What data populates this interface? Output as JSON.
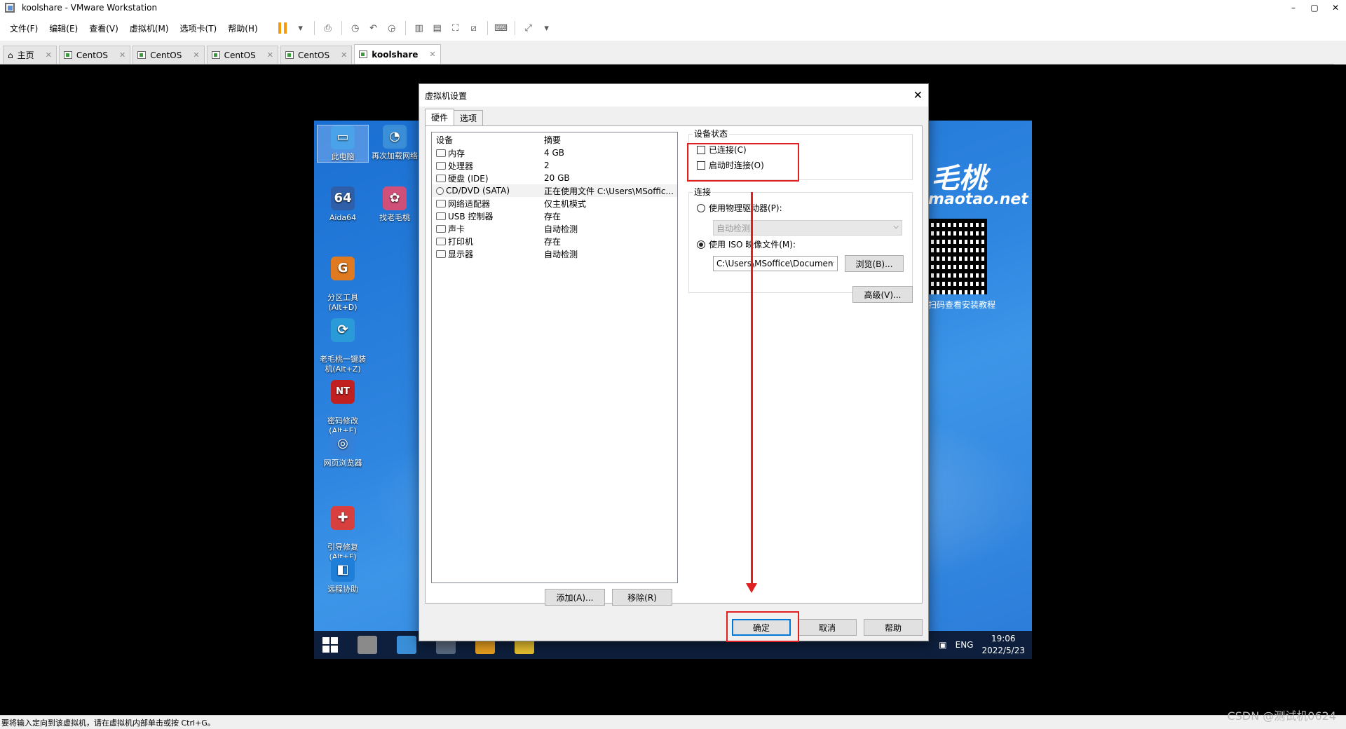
{
  "window": {
    "title": "koolshare - VMware Workstation",
    "controls": [
      "–",
      "▢",
      "✕"
    ]
  },
  "menu": {
    "items": [
      "文件(F)",
      "编辑(E)",
      "查看(V)",
      "虚拟机(M)",
      "选项卡(T)",
      "帮助(H)"
    ]
  },
  "tabs": [
    {
      "label": "主页",
      "active": false
    },
    {
      "label": "CentOS",
      "active": false
    },
    {
      "label": "CentOS",
      "active": false
    },
    {
      "label": "CentOS",
      "active": false
    },
    {
      "label": "CentOS",
      "active": false
    },
    {
      "label": "koolshare",
      "active": true
    }
  ],
  "guest": {
    "brand_text": "毛桃",
    "brand_url": "maotao.net",
    "qr_note": "扫码查看安装教程",
    "icons": [
      {
        "label": "此电脑",
        "color": "#4aa3e8",
        "glyph": "▭"
      },
      {
        "label": "再次加载网络",
        "color": "#3b8fd8",
        "glyph": "◔"
      },
      {
        "label": "Aida64",
        "color": "#2e5fa8",
        "glyph": "64"
      },
      {
        "label": "找老毛桃",
        "color": "#d0507a",
        "glyph": "✿"
      },
      {
        "label": "分区工具\n(Alt+D)",
        "color": "#e07a20",
        "glyph": "G"
      },
      {
        "label": "老毛桃一键装\n机(Alt+Z)",
        "color": "#2a9ad8",
        "glyph": "⟳"
      },
      {
        "label": "密码修改\n(Alt+E)",
        "color": "#c02020",
        "glyph": "NT"
      },
      {
        "label": "网页浏览器",
        "color": "#3580d8",
        "glyph": "◎"
      },
      {
        "label": "引导修复\n(Alt+F)",
        "color": "#d84040",
        "glyph": "✚"
      },
      {
        "label": "远程协助",
        "color": "#1f7fd8",
        "glyph": "◧"
      }
    ],
    "tray": {
      "lang": "ENG",
      "time": "19:06",
      "date": "2022/5/23"
    }
  },
  "dialog": {
    "title": "虚拟机设置",
    "tabs": [
      {
        "label": "硬件",
        "active": true
      },
      {
        "label": "选项",
        "active": false
      }
    ],
    "columns": {
      "device": "设备",
      "summary": "摘要"
    },
    "devices": [
      {
        "name": "内存",
        "summary": "4 GB",
        "selected": false
      },
      {
        "name": "处理器",
        "summary": "2",
        "selected": false
      },
      {
        "name": "硬盘 (IDE)",
        "summary": "20 GB",
        "selected": false
      },
      {
        "name": "CD/DVD (SATA)",
        "summary": "正在使用文件 C:\\Users\\MSoffic...",
        "selected": true
      },
      {
        "name": "网络适配器",
        "summary": "仅主机模式",
        "selected": false
      },
      {
        "name": "USB 控制器",
        "summary": "存在",
        "selected": false
      },
      {
        "name": "声卡",
        "summary": "自动检测",
        "selected": false
      },
      {
        "name": "打印机",
        "summary": "存在",
        "selected": false
      },
      {
        "name": "显示器",
        "summary": "自动检测",
        "selected": false
      }
    ],
    "add_button": "添加(A)...",
    "remove_button": "移除(R)",
    "device_status": {
      "label": "设备状态",
      "connected": {
        "label": "已连接(C)",
        "checked": false
      },
      "connect_at_power_on": {
        "label": "启动时连接(O)",
        "checked": false
      }
    },
    "connection": {
      "label": "连接",
      "physical_drive": {
        "label": "使用物理驱动器(P):",
        "selected": false
      },
      "physical_drive_value": "自动检测",
      "iso_image": {
        "label": "使用 ISO 映像文件(M):",
        "selected": true
      },
      "iso_path": "C:\\Users\\MSoffice\\Documen",
      "browse_button": "浏览(B)..."
    },
    "advanced_button": "高级(V)...",
    "ok_button": "确定",
    "cancel_button": "取消",
    "help_button": "帮助"
  },
  "statusbar": {
    "text": "要将输入定向到该虚拟机，请在虚拟机内部单击或按 Ctrl+G。"
  },
  "watermark": "CSDN @测试机0624",
  "annotation_color": "#e02020"
}
